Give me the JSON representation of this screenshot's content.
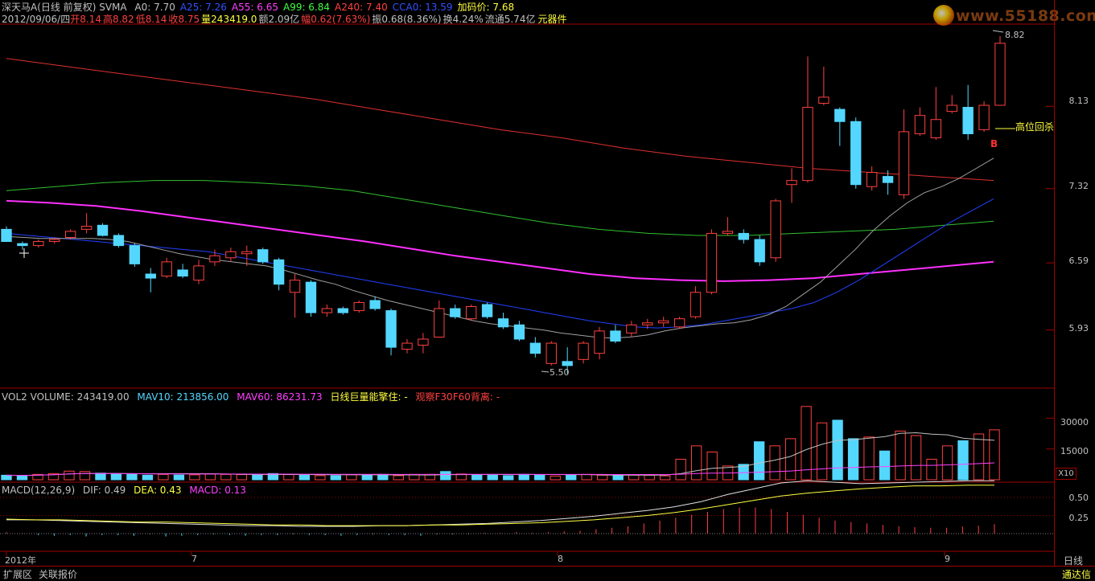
{
  "header": {
    "title": "深天马A(日线 前复权) SVMA",
    "ma_labels": [
      {
        "text": "A0: 7.70",
        "color": "#c0c0c0"
      },
      {
        "text": "A25: 7.26",
        "color": "#3050ff"
      },
      {
        "text": "A55: 6.65",
        "color": "#ff40ff"
      },
      {
        "text": "A99: 6.84",
        "color": "#40ff40"
      },
      {
        "text": "A240: 7.40",
        "color": "#ff4040"
      },
      {
        "text": "CCA0: 13.59",
        "color": "#3050ff"
      },
      {
        "text": "加码价: 7.68",
        "color": "#ffff40"
      }
    ],
    "quote_date": "2012/09/06/四",
    "quote_open_label": "开",
    "quote_open": "8.14",
    "quote_high_label": "高",
    "quote_high": "8.82",
    "quote_low_label": "低",
    "quote_low": "8.14",
    "quote_close_label": "收",
    "quote_close": "8.75",
    "quote_vol_label": "量",
    "quote_vol": "243419.0",
    "quote_amount": "额2.09亿",
    "quote_change_label": "幅",
    "quote_change": "0.62(7.63%)",
    "quote_amp": "振0.68(8.36%)",
    "quote_turnover": "换4.24%",
    "quote_float": "流通5.74亿",
    "quote_tool": "元器件"
  },
  "logo": {
    "text": "www.55188.com"
  },
  "price_axis": [
    "8.13",
    "7.32",
    "6.59",
    "5.93"
  ],
  "annotations": {
    "high_price": "8.82",
    "low_price": "5.50",
    "signal_text": "高位回杀",
    "signal_mark": "B"
  },
  "volume_header": {
    "vol": "VOL2 VOLUME: 243419.00",
    "mav10": "MAV10: 213856.00",
    "mav60": "MAV60: 86231.73",
    "signal1": "日线巨量能擎住: -",
    "signal2": "观察F30F60背离: -"
  },
  "volume_axis": [
    "30000",
    "15000"
  ],
  "volume_unit": "X10",
  "macd_header": {
    "name": "MACD(12,26,9)",
    "dif": "DIF: 0.49",
    "dea": "DEA: 0.43",
    "macd": "MACD: 0.13"
  },
  "macd_axis": [
    "0.50",
    "0.25"
  ],
  "date_axis": [
    "2012年",
    "7",
    "8",
    "9"
  ],
  "period_label": "日线",
  "footer": {
    "left1": "扩展区",
    "left2": "关联报价",
    "right": "通达信"
  },
  "colors": {
    "up": "#ff4040",
    "down": "#54d7ff",
    "ma_gray": "#c0c0c0",
    "ma_blue": "#2040ff",
    "ma_magenta": "#ff30ff",
    "ma_green": "#30c030",
    "ma_red": "#e03030"
  },
  "chart_data": {
    "type": "candlestick",
    "price_ticks": [
      5.93,
      6.59,
      7.32,
      8.13
    ],
    "candles": [
      [
        6.92,
        6.95,
        6.8,
        6.8
      ],
      [
        6.78,
        6.8,
        6.72,
        6.76
      ],
      [
        6.76,
        6.82,
        6.74,
        6.8
      ],
      [
        6.8,
        6.84,
        6.78,
        6.82
      ],
      [
        6.84,
        6.92,
        6.82,
        6.9
      ],
      [
        6.92,
        7.08,
        6.88,
        6.95
      ],
      [
        6.96,
        6.98,
        6.85,
        6.86
      ],
      [
        6.86,
        6.88,
        6.74,
        6.76
      ],
      [
        6.76,
        6.78,
        6.55,
        6.58
      ],
      [
        6.48,
        6.54,
        6.3,
        6.44
      ],
      [
        6.46,
        6.64,
        6.44,
        6.6
      ],
      [
        6.52,
        6.58,
        6.44,
        6.46
      ],
      [
        6.42,
        6.62,
        6.38,
        6.56
      ],
      [
        6.6,
        6.72,
        6.56,
        6.66
      ],
      [
        6.64,
        6.74,
        6.6,
        6.7
      ],
      [
        6.68,
        6.76,
        6.56,
        6.7
      ],
      [
        6.72,
        6.74,
        6.58,
        6.6
      ],
      [
        6.62,
        6.64,
        6.32,
        6.38
      ],
      [
        6.3,
        6.48,
        6.05,
        6.42
      ],
      [
        6.4,
        6.42,
        6.06,
        6.1
      ],
      [
        6.1,
        6.18,
        6.06,
        6.14
      ],
      [
        6.14,
        6.16,
        6.08,
        6.1
      ],
      [
        6.12,
        6.22,
        6.1,
        6.2
      ],
      [
        6.22,
        6.26,
        6.12,
        6.14
      ],
      [
        6.12,
        6.14,
        5.68,
        5.76
      ],
      [
        5.74,
        5.84,
        5.7,
        5.8
      ],
      [
        5.78,
        5.9,
        5.7,
        5.84
      ],
      [
        5.86,
        6.22,
        5.86,
        6.14
      ],
      [
        6.14,
        6.18,
        6.04,
        6.06
      ],
      [
        6.04,
        6.18,
        6.02,
        6.16
      ],
      [
        6.18,
        6.2,
        6.04,
        6.06
      ],
      [
        6.04,
        6.1,
        5.94,
        5.96
      ],
      [
        5.98,
        6.02,
        5.82,
        5.84
      ],
      [
        5.8,
        5.86,
        5.66,
        5.7
      ],
      [
        5.6,
        5.82,
        5.58,
        5.8
      ],
      [
        5.62,
        5.76,
        5.5,
        5.58
      ],
      [
        5.64,
        5.82,
        5.6,
        5.8
      ],
      [
        5.7,
        5.96,
        5.64,
        5.92
      ],
      [
        5.92,
        5.98,
        5.8,
        5.82
      ],
      [
        5.9,
        6.02,
        5.86,
        5.98
      ],
      [
        5.98,
        6.04,
        5.94,
        6.0
      ],
      [
        6.0,
        6.06,
        5.96,
        6.02
      ],
      [
        5.96,
        6.06,
        5.94,
        6.04
      ],
      [
        6.06,
        6.36,
        6.04,
        6.3
      ],
      [
        6.3,
        6.92,
        6.28,
        6.88
      ],
      [
        6.88,
        7.04,
        6.86,
        6.9
      ],
      [
        6.88,
        6.92,
        6.78,
        6.82
      ],
      [
        6.82,
        6.86,
        6.56,
        6.6
      ],
      [
        6.64,
        7.22,
        6.6,
        7.2
      ],
      [
        7.36,
        7.52,
        7.18,
        7.4
      ],
      [
        7.4,
        8.62,
        7.38,
        8.12
      ],
      [
        8.16,
        8.52,
        8.14,
        8.22
      ],
      [
        8.1,
        8.12,
        7.74,
        7.98
      ],
      [
        7.98,
        8.02,
        7.32,
        7.36
      ],
      [
        7.34,
        7.54,
        7.3,
        7.48
      ],
      [
        7.44,
        7.5,
        7.26,
        7.38
      ],
      [
        7.26,
        8.1,
        7.22,
        7.88
      ],
      [
        7.86,
        8.12,
        7.84,
        8.04
      ],
      [
        7.82,
        8.32,
        7.8,
        8.0
      ],
      [
        8.08,
        8.24,
        8.06,
        8.14
      ],
      [
        8.12,
        8.34,
        7.8,
        7.86
      ],
      [
        7.9,
        8.18,
        7.88,
        8.14
      ],
      [
        8.14,
        8.82,
        8.14,
        8.75
      ]
    ],
    "ma_gray": [
      6.85,
      6.84,
      6.83,
      6.83,
      6.83,
      6.83,
      6.82,
      6.8,
      6.76,
      6.72,
      6.68,
      6.65,
      6.62,
      6.6,
      6.58,
      6.56,
      6.52,
      6.47,
      6.42,
      6.38,
      6.32,
      6.27,
      6.22,
      6.18,
      6.14,
      6.1,
      6.06,
      6.02,
      5.99,
      5.97,
      5.95,
      5.93,
      5.9,
      5.88,
      5.86,
      5.85,
      5.86,
      5.88,
      5.92,
      5.95,
      5.97,
      5.99,
      6.0,
      6.03,
      6.08,
      6.16,
      6.28,
      6.4,
      6.56,
      6.72,
      6.9,
      7.05,
      7.18,
      7.28,
      7.34,
      7.42,
      7.52,
      7.62
    ],
    "ma_blue": [
      6.88,
      6.86,
      6.84,
      6.82,
      6.8,
      6.78,
      6.76,
      6.74,
      6.72,
      6.7,
      6.66,
      6.62,
      6.58,
      6.54,
      6.5,
      6.46,
      6.42,
      6.38,
      6.34,
      6.3,
      6.26,
      6.22,
      6.18,
      6.14,
      6.1,
      6.06,
      6.02,
      5.99,
      5.96,
      5.95,
      5.96,
      5.98,
      6.02,
      6.06,
      6.1,
      6.14,
      6.2,
      6.3,
      6.42,
      6.56,
      6.7,
      6.84,
      6.98,
      7.1,
      7.22
    ],
    "ma_magenta": [
      7.2,
      7.18,
      7.15,
      7.1,
      7.04,
      6.98,
      6.92,
      6.86,
      6.8,
      6.73,
      6.66,
      6.6,
      6.54,
      6.48,
      6.44,
      6.42,
      6.41,
      6.42,
      6.44,
      6.48,
      6.52,
      6.56,
      6.6
    ],
    "ma_green": [
      7.3,
      7.34,
      7.38,
      7.4,
      7.4,
      7.38,
      7.35,
      7.3,
      7.22,
      7.14,
      7.06,
      6.98,
      6.92,
      6.88,
      6.86,
      6.86,
      6.88,
      6.9,
      6.92,
      6.96,
      7.0
    ],
    "ma_red": [
      8.6,
      8.52,
      8.44,
      8.36,
      8.28,
      8.2,
      8.1,
      8.0,
      7.9,
      7.82,
      7.72,
      7.64,
      7.58,
      7.52,
      7.48,
      7.44,
      7.4
    ],
    "volume_ticks": [
      15000,
      30000
    ],
    "volumes": [
      2200,
      2000,
      2600,
      3000,
      4200,
      4000,
      3200,
      3000,
      2600,
      2200,
      2600,
      2300,
      2400,
      2800,
      2600,
      2500,
      2400,
      3000,
      2500,
      2200,
      2000,
      2000,
      2400,
      2200,
      2600,
      2000,
      2600,
      2600,
      4000,
      2800,
      2400,
      2200,
      2000,
      2600,
      2300,
      1800,
      2400,
      2600,
      2200,
      2000,
      2300,
      2200,
      1900,
      10000,
      16500,
      13500,
      6700,
      7500,
      18500,
      16500,
      20000,
      35700,
      27700,
      29000,
      20000,
      20800,
      14000,
      23700,
      21500,
      10000,
      16500,
      19000,
      22300,
      24300
    ],
    "macd_dif": [
      -0.05,
      -0.05,
      -0.06,
      -0.07,
      -0.08,
      -0.09,
      -0.1,
      -0.11,
      -0.12,
      -0.13,
      -0.13,
      -0.14,
      -0.14,
      -0.14,
      -0.13,
      -0.13,
      -0.12,
      -0.11,
      -0.1,
      -0.08,
      -0.06,
      -0.03,
      0,
      0.04,
      0.08,
      0.13,
      0.2,
      0.3,
      0.38,
      0.46,
      0.49,
      0.47,
      0.45,
      0.46,
      0.47,
      0.48,
      0.49,
      0.49
    ],
    "macd_dea": [
      -0.04,
      -0.05,
      -0.05,
      -0.06,
      -0.07,
      -0.08,
      -0.08,
      -0.09,
      -0.1,
      -0.11,
      -0.12,
      -0.12,
      -0.13,
      -0.13,
      -0.13,
      -0.13,
      -0.12,
      -0.12,
      -0.11,
      -0.1,
      -0.09,
      -0.07,
      -0.05,
      -0.02,
      0.01,
      0.05,
      0.1,
      0.16,
      0.22,
      0.28,
      0.32,
      0.35,
      0.38,
      0.4,
      0.42,
      0.42,
      0.43,
      0.43
    ],
    "macd_hist": [
      0.02,
      0.01,
      -0.02,
      -0.03,
      -0.02,
      -0.04,
      -0.02,
      -0.02,
      -0.03,
      -0.01,
      -0.04,
      -0.03,
      -0.02,
      -0.01,
      -0.02,
      -0.03,
      -0.02,
      -0.02,
      -0.01,
      -0.02,
      -0.02,
      -0.03,
      -0.02,
      -0.01,
      -0.02,
      -0.02,
      -0.03,
      -0.01,
      -0.01,
      -0.01,
      0.01,
      0.01,
      0.02,
      0.01,
      0.02,
      0.03,
      0.04,
      0.06,
      0.08,
      0.1,
      0.14,
      0.18,
      0.22,
      0.26,
      0.3,
      0.34,
      0.36,
      0.36,
      0.34,
      0.3,
      0.26,
      0.22,
      0.18,
      0.16,
      0.14,
      0.12,
      0.1,
      0.09,
      0.08,
      0.08,
      0.1,
      0.11,
      0.13
    ]
  }
}
